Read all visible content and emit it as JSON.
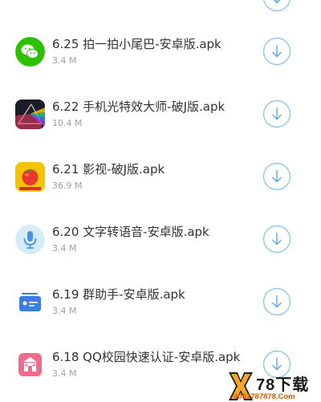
{
  "downloads": [
    {
      "title": "6.25 拍一拍小尾巴-安卓版.apk",
      "size": "3.4 M",
      "icon": "wechat-icon",
      "color": "#2dc100"
    },
    {
      "title": "6.22 手机光特效大师-破J版.apk",
      "size": "10.4 M",
      "icon": "prism-light-icon",
      "color": "#1c1c28"
    },
    {
      "title": "6.21 影视-破J版.apk",
      "size": "36.9 M",
      "icon": "tomato-icon",
      "color": "#f5c400"
    },
    {
      "title": "6.20 文字转语音-安卓版.apk",
      "size": "3.4 M",
      "icon": "microphone-icon",
      "color": "#4a90e2"
    },
    {
      "title": "6.19 群助手-安卓版.apk",
      "size": "3.4 M",
      "icon": "card-icon",
      "color": "#3b7de0"
    },
    {
      "title": "6.18 QQ校园快速认证-安卓版.apk",
      "size": "3.4 M",
      "icon": "school-icon",
      "color": "#f06b8a"
    }
  ],
  "download_button_icon": "download-circle-icon",
  "accent_color": "#3b9ee6",
  "watermark": {
    "brand": "78下载",
    "phone": "4007787878.Com"
  }
}
